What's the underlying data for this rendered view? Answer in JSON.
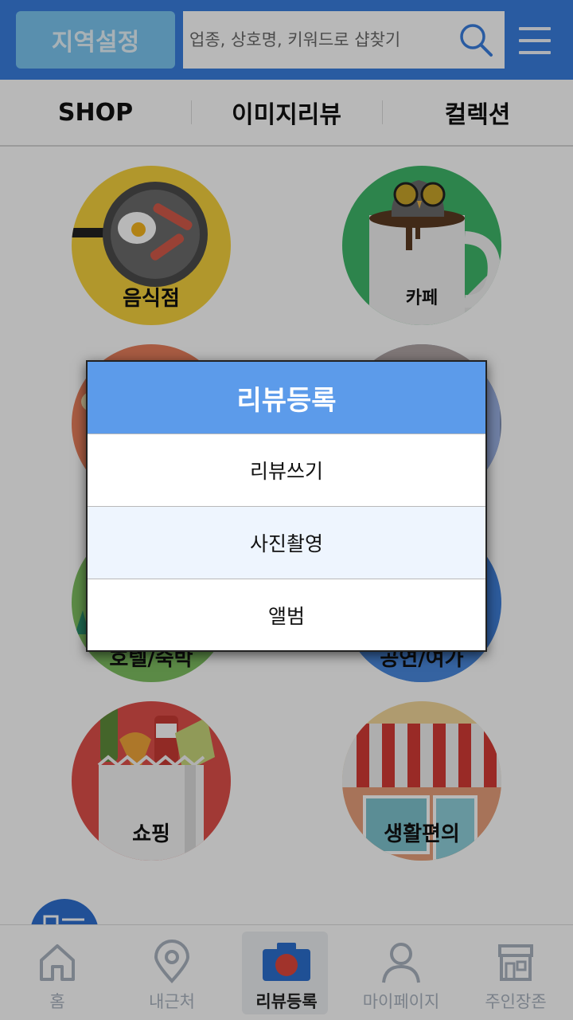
{
  "header": {
    "region_button": "지역설정",
    "search_placeholder": "업종, 상호명, 키워드로 샵찾기",
    "search_icon": "search-icon",
    "menu_icon": "hamburger-menu-icon",
    "colors": {
      "bar": "#3a7ee0",
      "region": "#7cc7f2"
    }
  },
  "tabs": [
    {
      "label": "SHOP"
    },
    {
      "label": "이미지리뷰"
    },
    {
      "label": "컬렉션"
    }
  ],
  "categories": [
    {
      "label": "음식점",
      "icon": "frying-pan-icon"
    },
    {
      "label": "카페",
      "icon": "coffee-cup-owl-icon"
    },
    {
      "label": "",
      "icon": "beauty-icon"
    },
    {
      "label": "",
      "icon": "building-icon"
    },
    {
      "label": "호텔/숙박",
      "icon": "hotel-icon"
    },
    {
      "label": "공연/여가",
      "icon": "leisure-icon"
    },
    {
      "label": "쇼핑",
      "icon": "shopping-bag-icon"
    },
    {
      "label": "생활편의",
      "icon": "storefront-icon"
    }
  ],
  "dialog": {
    "title": "리뷰등록",
    "options": [
      {
        "label": "리뷰쓰기"
      },
      {
        "label": "사진촬영"
      },
      {
        "label": "앨범"
      }
    ],
    "colors": {
      "title_bg": "#5c9bea",
      "highlight": "#eef5fe"
    }
  },
  "bottom_nav": [
    {
      "label": "홈",
      "icon": "home-icon"
    },
    {
      "label": "내근처",
      "icon": "location-pin-icon"
    },
    {
      "label": "리뷰등록",
      "icon": "camera-icon",
      "active": true
    },
    {
      "label": "마이페이지",
      "icon": "person-icon"
    },
    {
      "label": "주인장존",
      "icon": "store-icon"
    }
  ]
}
